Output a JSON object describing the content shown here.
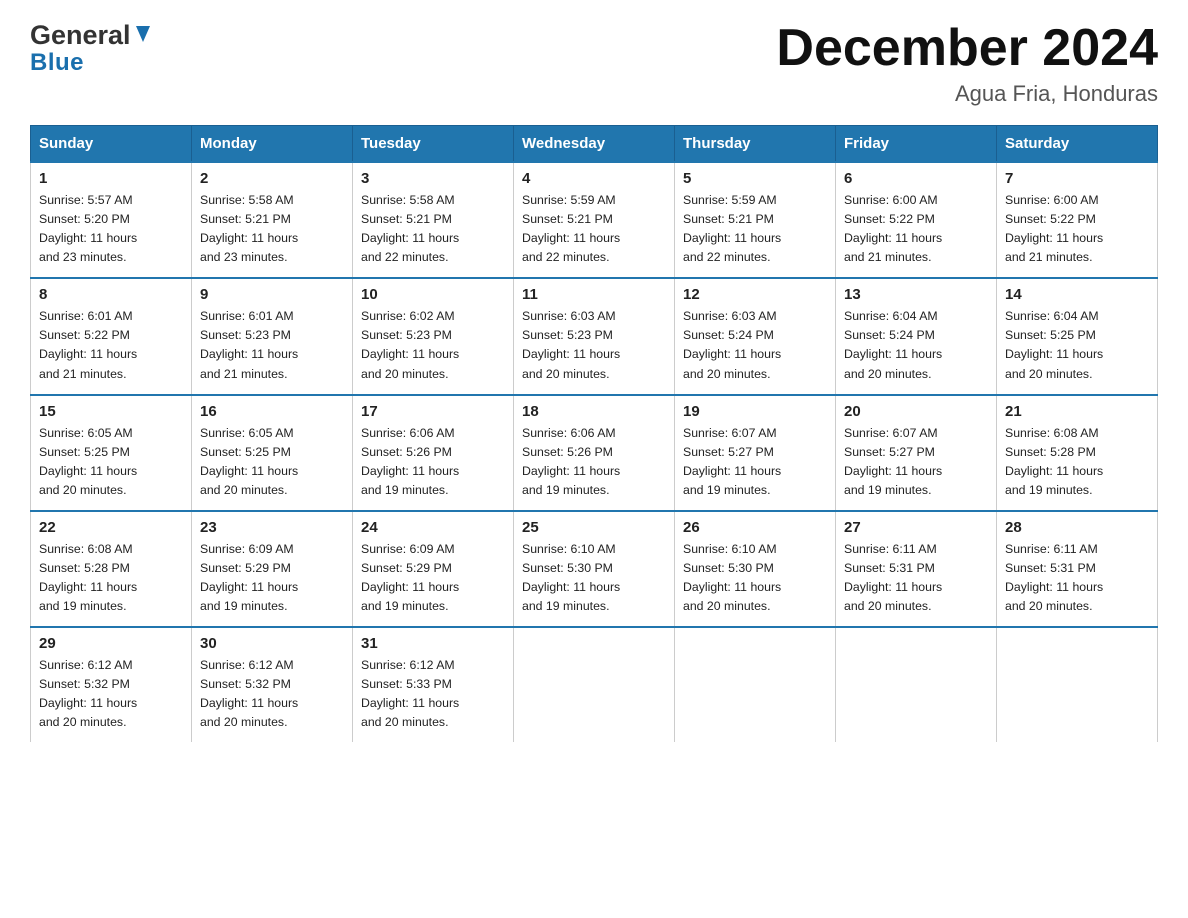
{
  "logo": {
    "general": "General",
    "blue": "Blue"
  },
  "title": "December 2024",
  "location": "Agua Fria, Honduras",
  "days_of_week": [
    "Sunday",
    "Monday",
    "Tuesday",
    "Wednesday",
    "Thursday",
    "Friday",
    "Saturday"
  ],
  "weeks": [
    [
      {
        "num": "1",
        "sunrise": "5:57 AM",
        "sunset": "5:20 PM",
        "daylight": "11 hours and 23 minutes."
      },
      {
        "num": "2",
        "sunrise": "5:58 AM",
        "sunset": "5:21 PM",
        "daylight": "11 hours and 23 minutes."
      },
      {
        "num": "3",
        "sunrise": "5:58 AM",
        "sunset": "5:21 PM",
        "daylight": "11 hours and 22 minutes."
      },
      {
        "num": "4",
        "sunrise": "5:59 AM",
        "sunset": "5:21 PM",
        "daylight": "11 hours and 22 minutes."
      },
      {
        "num": "5",
        "sunrise": "5:59 AM",
        "sunset": "5:21 PM",
        "daylight": "11 hours and 22 minutes."
      },
      {
        "num": "6",
        "sunrise": "6:00 AM",
        "sunset": "5:22 PM",
        "daylight": "11 hours and 21 minutes."
      },
      {
        "num": "7",
        "sunrise": "6:00 AM",
        "sunset": "5:22 PM",
        "daylight": "11 hours and 21 minutes."
      }
    ],
    [
      {
        "num": "8",
        "sunrise": "6:01 AM",
        "sunset": "5:22 PM",
        "daylight": "11 hours and 21 minutes."
      },
      {
        "num": "9",
        "sunrise": "6:01 AM",
        "sunset": "5:23 PM",
        "daylight": "11 hours and 21 minutes."
      },
      {
        "num": "10",
        "sunrise": "6:02 AM",
        "sunset": "5:23 PM",
        "daylight": "11 hours and 20 minutes."
      },
      {
        "num": "11",
        "sunrise": "6:03 AM",
        "sunset": "5:23 PM",
        "daylight": "11 hours and 20 minutes."
      },
      {
        "num": "12",
        "sunrise": "6:03 AM",
        "sunset": "5:24 PM",
        "daylight": "11 hours and 20 minutes."
      },
      {
        "num": "13",
        "sunrise": "6:04 AM",
        "sunset": "5:24 PM",
        "daylight": "11 hours and 20 minutes."
      },
      {
        "num": "14",
        "sunrise": "6:04 AM",
        "sunset": "5:25 PM",
        "daylight": "11 hours and 20 minutes."
      }
    ],
    [
      {
        "num": "15",
        "sunrise": "6:05 AM",
        "sunset": "5:25 PM",
        "daylight": "11 hours and 20 minutes."
      },
      {
        "num": "16",
        "sunrise": "6:05 AM",
        "sunset": "5:25 PM",
        "daylight": "11 hours and 20 minutes."
      },
      {
        "num": "17",
        "sunrise": "6:06 AM",
        "sunset": "5:26 PM",
        "daylight": "11 hours and 19 minutes."
      },
      {
        "num": "18",
        "sunrise": "6:06 AM",
        "sunset": "5:26 PM",
        "daylight": "11 hours and 19 minutes."
      },
      {
        "num": "19",
        "sunrise": "6:07 AM",
        "sunset": "5:27 PM",
        "daylight": "11 hours and 19 minutes."
      },
      {
        "num": "20",
        "sunrise": "6:07 AM",
        "sunset": "5:27 PM",
        "daylight": "11 hours and 19 minutes."
      },
      {
        "num": "21",
        "sunrise": "6:08 AM",
        "sunset": "5:28 PM",
        "daylight": "11 hours and 19 minutes."
      }
    ],
    [
      {
        "num": "22",
        "sunrise": "6:08 AM",
        "sunset": "5:28 PM",
        "daylight": "11 hours and 19 minutes."
      },
      {
        "num": "23",
        "sunrise": "6:09 AM",
        "sunset": "5:29 PM",
        "daylight": "11 hours and 19 minutes."
      },
      {
        "num": "24",
        "sunrise": "6:09 AM",
        "sunset": "5:29 PM",
        "daylight": "11 hours and 19 minutes."
      },
      {
        "num": "25",
        "sunrise": "6:10 AM",
        "sunset": "5:30 PM",
        "daylight": "11 hours and 19 minutes."
      },
      {
        "num": "26",
        "sunrise": "6:10 AM",
        "sunset": "5:30 PM",
        "daylight": "11 hours and 20 minutes."
      },
      {
        "num": "27",
        "sunrise": "6:11 AM",
        "sunset": "5:31 PM",
        "daylight": "11 hours and 20 minutes."
      },
      {
        "num": "28",
        "sunrise": "6:11 AM",
        "sunset": "5:31 PM",
        "daylight": "11 hours and 20 minutes."
      }
    ],
    [
      {
        "num": "29",
        "sunrise": "6:12 AM",
        "sunset": "5:32 PM",
        "daylight": "11 hours and 20 minutes."
      },
      {
        "num": "30",
        "sunrise": "6:12 AM",
        "sunset": "5:32 PM",
        "daylight": "11 hours and 20 minutes."
      },
      {
        "num": "31",
        "sunrise": "6:12 AM",
        "sunset": "5:33 PM",
        "daylight": "11 hours and 20 minutes."
      },
      null,
      null,
      null,
      null
    ]
  ],
  "labels": {
    "sunrise": "Sunrise:",
    "sunset": "Sunset:",
    "daylight": "Daylight:"
  }
}
